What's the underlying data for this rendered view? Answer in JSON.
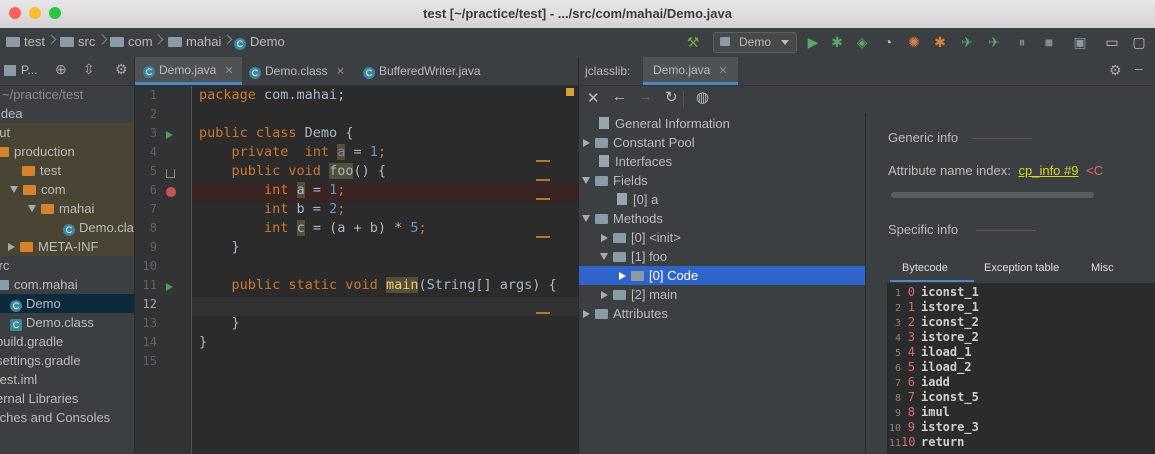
{
  "window": {
    "title": "test [~/practice/test] - .../src/com/mahai/Demo.java"
  },
  "breadcrumbs": [
    "test",
    "src",
    "com",
    "mahai",
    "Demo"
  ],
  "toolbar": {
    "run_config": "Demo"
  },
  "project_panel": {
    "title": "P...",
    "items": [
      {
        "label": "~/practice/test"
      },
      {
        "label": "idea"
      },
      {
        "label": "out"
      },
      {
        "label": "production"
      },
      {
        "label": "test"
      },
      {
        "label": "com"
      },
      {
        "label": "mahai"
      },
      {
        "label": "Demo.cla"
      },
      {
        "label": "META-INF"
      },
      {
        "label": "src"
      },
      {
        "label": "com.mahai"
      },
      {
        "label": "Demo"
      },
      {
        "label": "Demo.class"
      },
      {
        "label": "build.gradle"
      },
      {
        "label": "settings.gradle"
      },
      {
        "label": "test.iml"
      },
      {
        "label": "ernal Libraries"
      },
      {
        "label": "tches and Consoles"
      }
    ]
  },
  "editor_tabs": [
    {
      "label": "Demo.java",
      "active": true
    },
    {
      "label": "Demo.class",
      "active": false
    },
    {
      "label": "BufferedWriter.java",
      "active": false
    }
  ],
  "code": {
    "line_numbers": [
      "1",
      "2",
      "3",
      "4",
      "5",
      "6",
      "7",
      "8",
      "9",
      "10",
      "11",
      "12",
      "13",
      "14",
      "15"
    ],
    "l1_kw": "package",
    "l1_rest": " com.mahai;",
    "l3_kw": "public class",
    "l3_rest": " Demo {",
    "l4_kw1": "private",
    "l4_kw2": "int",
    "l4_var": "a",
    "l4_rest": " = ",
    "l4_num": "1",
    "l4_end": ";",
    "l5_kw": "public void",
    "l5_fn": "foo",
    "l5_rest": "() {",
    "l6_kw": "int",
    "l6_var": "a",
    "l6_rest": " = ",
    "l6_num": "1",
    "l6_end": ";",
    "l7_kw": "int",
    "l7_rest": " b = ",
    "l7_num": "2",
    "l7_end": ";",
    "l8_kw": "int",
    "l8_var": "c",
    "l8_rest": " = (a + b) * ",
    "l8_num": "5",
    "l8_end": ";",
    "l9": "}",
    "l11_kw": "public static void",
    "l11_fn": "main",
    "l11_rest": "(String[] args) {",
    "l13": "}",
    "l14": "}"
  },
  "jclasslib": {
    "label": "jclasslib:",
    "tab": "Demo.java",
    "tree": [
      {
        "label": "General Information"
      },
      {
        "label": "Constant Pool"
      },
      {
        "label": "Interfaces"
      },
      {
        "label": "Fields"
      },
      {
        "label": "[0] a"
      },
      {
        "label": "Methods"
      },
      {
        "label": "[0] <init>"
      },
      {
        "label": "[1] foo"
      },
      {
        "label": "[0] Code"
      },
      {
        "label": "[2] main"
      },
      {
        "label": "Attributes"
      }
    ],
    "generic_info": "Generic info",
    "attr_label": "Attribute name index:",
    "attr_link": "cp_info #9",
    "attr_value": "<C",
    "specific_info": "Specific info",
    "tabs": [
      "Bytecode",
      "Exception table",
      "Misc"
    ],
    "bytecode": [
      {
        "line": "1",
        "offset": "0",
        "op": "iconst_1"
      },
      {
        "line": "2",
        "offset": "1",
        "op": "istore_1"
      },
      {
        "line": "3",
        "offset": "2",
        "op": "iconst_2"
      },
      {
        "line": "4",
        "offset": "3",
        "op": "istore_2"
      },
      {
        "line": "5",
        "offset": "4",
        "op": "iload_1"
      },
      {
        "line": "6",
        "offset": "5",
        "op": "iload_2"
      },
      {
        "line": "7",
        "offset": "6",
        "op": "iadd"
      },
      {
        "line": "8",
        "offset": "7",
        "op": "iconst_5"
      },
      {
        "line": "9",
        "offset": "8",
        "op": "imul"
      },
      {
        "line": "10",
        "offset": "9",
        "op": "istore_3"
      },
      {
        "line": "11",
        "offset": "10",
        "op": "return"
      }
    ]
  },
  "colors": {
    "accent": "#4a88c7",
    "selection": "#2f65ca",
    "keyword": "#cc7832",
    "number": "#6897bb",
    "function": "#ffc66d",
    "link": "#d6d62a",
    "bytecode_offset": "#e36a6a"
  }
}
